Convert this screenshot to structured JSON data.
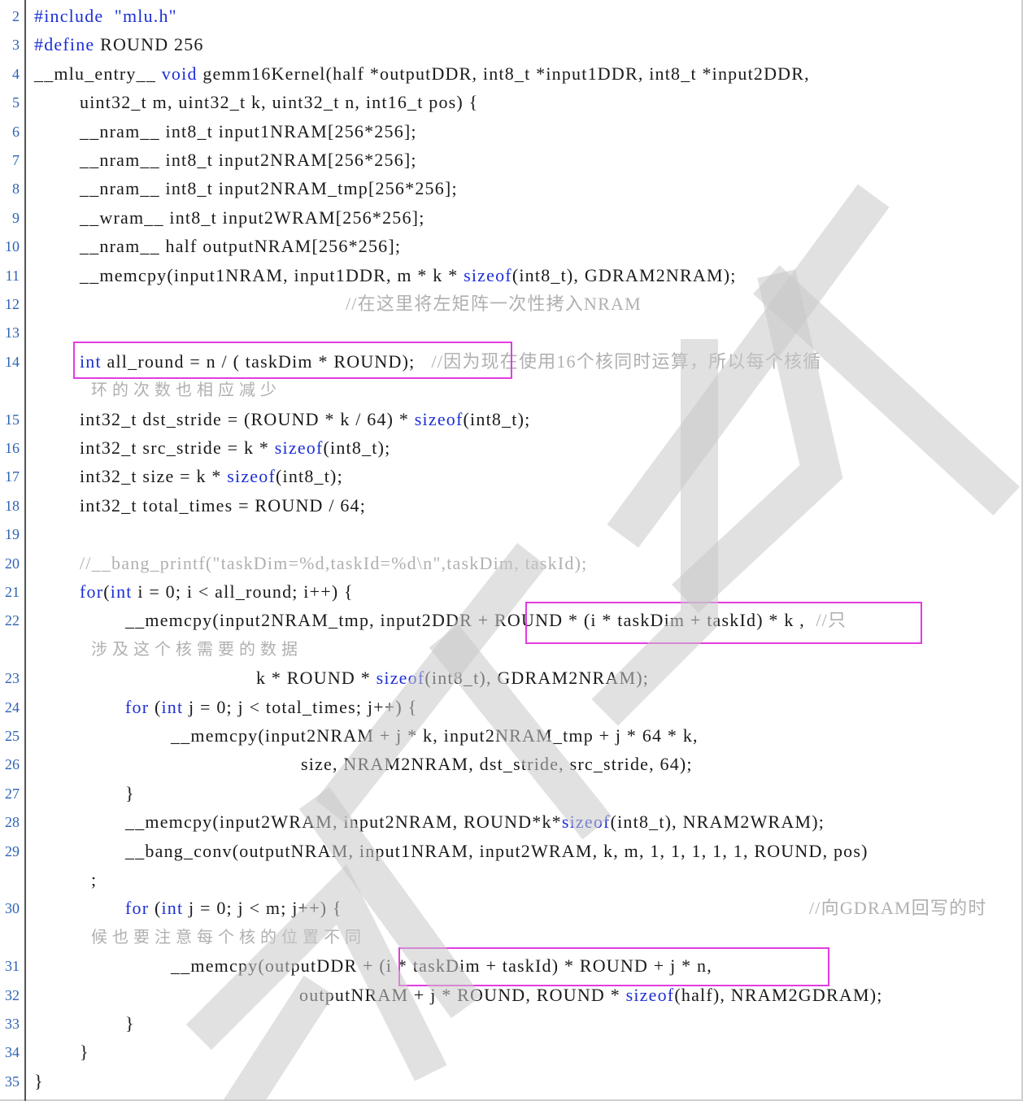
{
  "lines": [
    {
      "n": "2",
      "indent": 0,
      "parts": [
        [
          "kw",
          "#include"
        ],
        [
          "t",
          "  "
        ],
        [
          "kw",
          "\"mlu.h\""
        ]
      ]
    },
    {
      "n": "3",
      "indent": 0,
      "parts": [
        [
          "kw",
          "#define"
        ],
        [
          "t",
          " ROUND 256"
        ]
      ]
    },
    {
      "n": "4",
      "indent": 0,
      "parts": [
        [
          "t",
          "__mlu_entry__ "
        ],
        [
          "kw",
          "void"
        ],
        [
          "t",
          " gemm16Kernel(half *outputDDR, int8_t *input1DDR, int8_t *input2DDR,"
        ]
      ]
    },
    {
      "n": "5",
      "indent": 1,
      "parts": [
        [
          "t",
          "uint32_t m, uint32_t k, uint32_t n, int16_t pos) {"
        ]
      ]
    },
    {
      "n": "6",
      "indent": 1,
      "parts": [
        [
          "t",
          "__nram__ int8_t input1NRAM[256*256];"
        ]
      ]
    },
    {
      "n": "7",
      "indent": 1,
      "parts": [
        [
          "t",
          "__nram__ int8_t input2NRAM[256*256];"
        ]
      ]
    },
    {
      "n": "8",
      "indent": 1,
      "parts": [
        [
          "t",
          "__nram__ int8_t input2NRAM_tmp[256*256];"
        ]
      ]
    },
    {
      "n": "9",
      "indent": 1,
      "parts": [
        [
          "t",
          "__wram__ int8_t input2WRAM[256*256];"
        ]
      ]
    },
    {
      "n": "10",
      "indent": 1,
      "parts": [
        [
          "t",
          "__nram__ half outputNRAM[256*256];"
        ]
      ]
    },
    {
      "n": "11",
      "indent": 1,
      "parts": [
        [
          "t",
          "__memcpy(input1NRAM, input1DDR, m * k * "
        ],
        [
          "kw",
          "sizeof"
        ],
        [
          "t",
          "(int8_t), GDRAM2NRAM);"
        ]
      ]
    },
    {
      "n": "12",
      "indent": 0,
      "pad": 425,
      "parts": [
        [
          "cm",
          "//在这里将左矩阵一次性拷入NRAM"
        ]
      ]
    },
    {
      "n": "13",
      "indent": 0,
      "parts": []
    },
    {
      "n": "14",
      "indent": 1,
      "parts": [
        [
          "kw",
          "int"
        ],
        [
          "t",
          " all_round = n / ( taskDim * ROUND);"
        ],
        [
          "t",
          "   "
        ],
        [
          "cm",
          "//因为现在使用16个核同时运算，所以每个核循"
        ]
      ]
    },
    {
      "n": "",
      "indent": 0,
      "cont": true,
      "parts": [
        [
          "cm",
          "环的次数也相应减少"
        ]
      ]
    },
    {
      "n": "15",
      "indent": 1,
      "parts": [
        [
          "t",
          "int32_t dst_stride = (ROUND * k / 64) * "
        ],
        [
          "kw",
          "sizeof"
        ],
        [
          "t",
          "(int8_t);"
        ]
      ]
    },
    {
      "n": "16",
      "indent": 1,
      "parts": [
        [
          "t",
          "int32_t src_stride = k * "
        ],
        [
          "kw",
          "sizeof"
        ],
        [
          "t",
          "(int8_t);"
        ]
      ]
    },
    {
      "n": "17",
      "indent": 1,
      "parts": [
        [
          "t",
          "int32_t size = k * "
        ],
        [
          "kw",
          "sizeof"
        ],
        [
          "t",
          "(int8_t);"
        ]
      ]
    },
    {
      "n": "18",
      "indent": 1,
      "parts": [
        [
          "t",
          "int32_t total_times = ROUND / 64;"
        ]
      ]
    },
    {
      "n": "19",
      "indent": 0,
      "parts": []
    },
    {
      "n": "20",
      "indent": 1,
      "parts": [
        [
          "cm",
          "//__bang_printf(\"taskDim=%d,taskId=%d\\n\",taskDim, taskId);"
        ]
      ]
    },
    {
      "n": "21",
      "indent": 1,
      "parts": [
        [
          "kw",
          "for"
        ],
        [
          "t",
          "("
        ],
        [
          "kw",
          "int"
        ],
        [
          "t",
          " i = 0; i < all_round; i++) {"
        ]
      ]
    },
    {
      "n": "22",
      "indent": 2,
      "parts": [
        [
          "t",
          "__memcpy(input2NRAM_tmp, input2DDR + ROUND * (i * taskDim + taskId) * k ,  "
        ],
        [
          "cm",
          "//只"
        ]
      ]
    },
    {
      "n": "",
      "indent": 0,
      "cont": true,
      "parts": [
        [
          "cm",
          "涉及这个核需要的数据"
        ]
      ]
    },
    {
      "n": "23",
      "indent": 0,
      "pad": 315,
      "parts": [
        [
          "t",
          "k * ROUND * "
        ],
        [
          "kw",
          "sizeof"
        ],
        [
          "t",
          "(int8_t), GDRAM2NRAM);"
        ]
      ]
    },
    {
      "n": "24",
      "indent": 2,
      "parts": [
        [
          "kw",
          "for"
        ],
        [
          "t",
          " ("
        ],
        [
          "kw",
          "int"
        ],
        [
          "t",
          " j = 0; j < total_times; j++) {"
        ]
      ]
    },
    {
      "n": "25",
      "indent": 3,
      "parts": [
        [
          "t",
          "__memcpy(input2NRAM + j * k, input2NRAM_tmp + j * 64 * k,"
        ]
      ]
    },
    {
      "n": "26",
      "indent": 0,
      "pad": 370,
      "parts": [
        [
          "t",
          "size, NRAM2NRAM, dst_stride, src_stride, 64);"
        ]
      ]
    },
    {
      "n": "27",
      "indent": 2,
      "parts": [
        [
          "t",
          "}"
        ]
      ]
    },
    {
      "n": "28",
      "indent": 2,
      "parts": [
        [
          "t",
          "__memcpy(input2WRAM, input2NRAM, ROUND*k*"
        ],
        [
          "kw",
          "sizeof"
        ],
        [
          "t",
          "(int8_t), NRAM2WRAM);"
        ]
      ]
    },
    {
      "n": "29",
      "indent": 2,
      "parts": [
        [
          "t",
          "__bang_conv(outputNRAM, input1NRAM, input2WRAM, k, m, 1, 1, 1, 1, 1, ROUND, pos)"
        ]
      ]
    },
    {
      "n": "",
      "indent": 0,
      "cont": true,
      "plain": true,
      "parts": [
        [
          "t",
          ";"
        ]
      ]
    },
    {
      "n": "30",
      "indent": 2,
      "parts": [
        [
          "kw",
          "for"
        ],
        [
          "t",
          " ("
        ],
        [
          "kw",
          "int"
        ],
        [
          "t",
          " j = 0; j < m; j++) {"
        ]
      ],
      "tail": [
        [
          "cm",
          "//向GDRAM回写的时"
        ]
      ]
    },
    {
      "n": "",
      "indent": 0,
      "cont": true,
      "parts": [
        [
          "cm",
          "候也要注意每个核的位置不同"
        ]
      ]
    },
    {
      "n": "31",
      "indent": 3,
      "parts": [
        [
          "t",
          "__memcpy(outputDDR + (i * taskDim + taskId) * ROUND + j * n,"
        ]
      ]
    },
    {
      "n": "32",
      "indent": 0,
      "pad": 368,
      "parts": [
        [
          "t",
          "outputNRAM + j * ROUND, ROUND * "
        ],
        [
          "kw",
          "sizeof"
        ],
        [
          "t",
          "(half), NRAM2GDRAM);"
        ]
      ]
    },
    {
      "n": "33",
      "indent": 2,
      "parts": [
        [
          "t",
          "}"
        ]
      ]
    },
    {
      "n": "34",
      "indent": 1,
      "parts": [
        [
          "t",
          "}"
        ]
      ]
    },
    {
      "n": "35",
      "indent": 0,
      "parts": [
        [
          "t",
          "}"
        ]
      ]
    }
  ],
  "watermark_text": "科院计算所",
  "colors": {
    "keyword": "#1c2fd6",
    "comment": "#b0b0b0",
    "line_number": "#2d63b5",
    "highlight": "#e33ce0"
  }
}
